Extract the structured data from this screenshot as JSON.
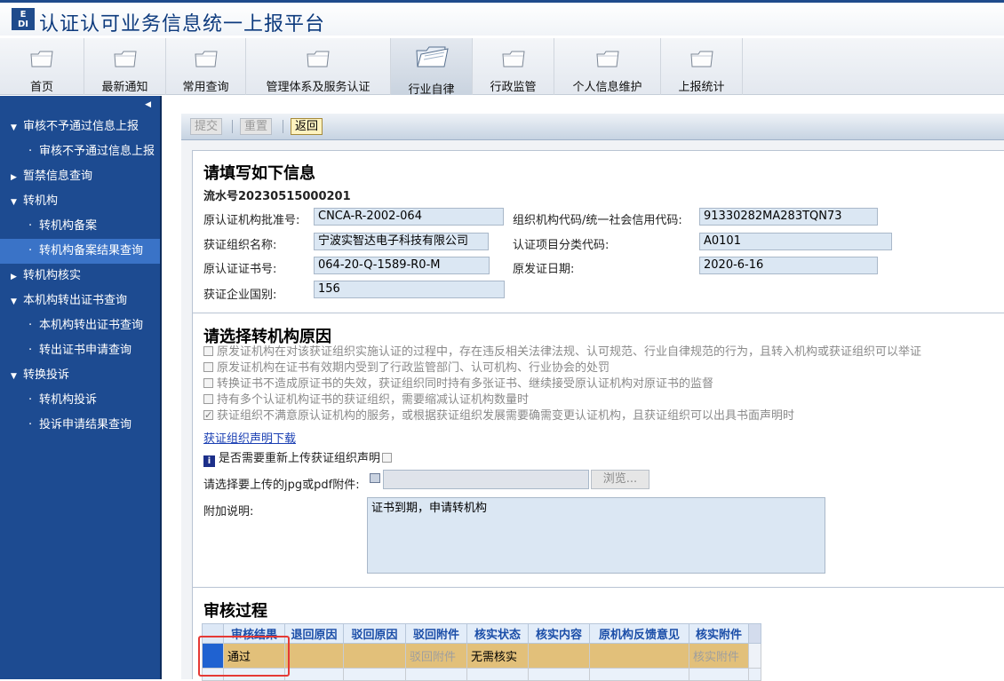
{
  "app": {
    "logo_text": "E\nDI",
    "title": "认证认可业务信息统一上报平台"
  },
  "topnav": [
    {
      "label": "首页"
    },
    {
      "label": "最新通知"
    },
    {
      "label": "常用查询"
    },
    {
      "label": "管理体系及服务认证"
    },
    {
      "label": "行业自律"
    },
    {
      "label": "行政监管"
    },
    {
      "label": "个人信息维护"
    },
    {
      "label": "上报统计"
    }
  ],
  "sidebar": {
    "collapse_glyph": "◀",
    "items": [
      {
        "label": "审核不予通过信息上报",
        "arrow": "▼"
      },
      {
        "label": "审核不予通过信息上报",
        "dot": "·"
      },
      {
        "label": "暂禁信息查询",
        "arrow": "▶"
      },
      {
        "label": "转机构",
        "arrow": "▼"
      },
      {
        "label": "转机构备案",
        "dot": "·"
      },
      {
        "label": "转机构备案结果查询",
        "dot": "·"
      },
      {
        "label": "转机构核实",
        "arrow": "▶"
      },
      {
        "label": "本机构转出证书查询",
        "arrow": "▼"
      },
      {
        "label": "本机构转出证书查询",
        "dot": "·"
      },
      {
        "label": "转出证书申请查询",
        "dot": "·"
      },
      {
        "label": "转换投诉",
        "arrow": "▼"
      },
      {
        "label": "转机构投诉",
        "dot": "·"
      },
      {
        "label": "投诉申请结果查询",
        "dot": "·"
      }
    ]
  },
  "toolbar": {
    "submit": "提交",
    "reset": "重置",
    "back": "返回"
  },
  "info": {
    "heading": "请填写如下信息",
    "serial": "流水号20230515000201",
    "fields": {
      "orig_approval_label": "原认证机构批准号:",
      "orig_approval": "CNCA-R-2002-064",
      "org_code_label": "组织机构代码/统一社会信用代码:",
      "org_code": "91330282MA283TQN73",
      "org_name_label": "获证组织名称:",
      "org_name": "宁波实智达电子科技有限公司",
      "category_label": "认证项目分类代码:",
      "category": "A0101",
      "cert_no_label": "原认证证书号:",
      "cert_no": "064-20-Q-1589-R0-M",
      "issue_date_label": "原发证日期:",
      "issue_date": "2020-6-16",
      "country_label": "获证企业国别:",
      "country": "156"
    }
  },
  "reason": {
    "heading": "请选择转机构原因",
    "options": [
      {
        "text": "原发证机构在对该获证组织实施认证的过程中，存在违反相关法律法规、认可规范、行业自律规范的行为，且转入机构或获证组织可以举证",
        "checked": false
      },
      {
        "text": "原发证机构在证书有效期内受到了行政监管部门、认可机构、行业协会的处罚",
        "checked": false
      },
      {
        "text": "转换证书不造成原证书的失效，获证组织同时持有多张证书、继续接受原认证机构对原证书的监督",
        "checked": false
      },
      {
        "text": "持有多个认证机构证书的获证组织，需要缩减认证机构数量时",
        "checked": false
      },
      {
        "text": "获证组织不满意原认证机构的服务，或根据获证组织发展需要确需变更认证机构，且获证组织可以出具书面声明时",
        "checked": true
      }
    ],
    "download_link": "获证组织声明下载",
    "reupload_label": "是否需要重新上传获证组织声明",
    "upload_label": "请选择要上传的jpg或pdf附件:",
    "upload_value": "",
    "browse": "浏览...",
    "note_label": "附加说明:",
    "note_value": "证书到期，申请转机构"
  },
  "audit": {
    "heading": "审核过程",
    "columns": [
      "审核结果",
      "退回原因",
      "驳回原因",
      "驳回附件",
      "核实状态",
      "核实内容",
      "原机构反馈意见",
      "核实附件"
    ],
    "rows": [
      [
        "通过",
        "",
        "",
        "驳回附件",
        "无需核实",
        "",
        "",
        "核实附件"
      ]
    ]
  },
  "colors": {
    "sidebar": "#1d4b91",
    "title": "#0d3a7d",
    "selected_row": "#e2c07a",
    "highlight_box": "#e53935"
  }
}
